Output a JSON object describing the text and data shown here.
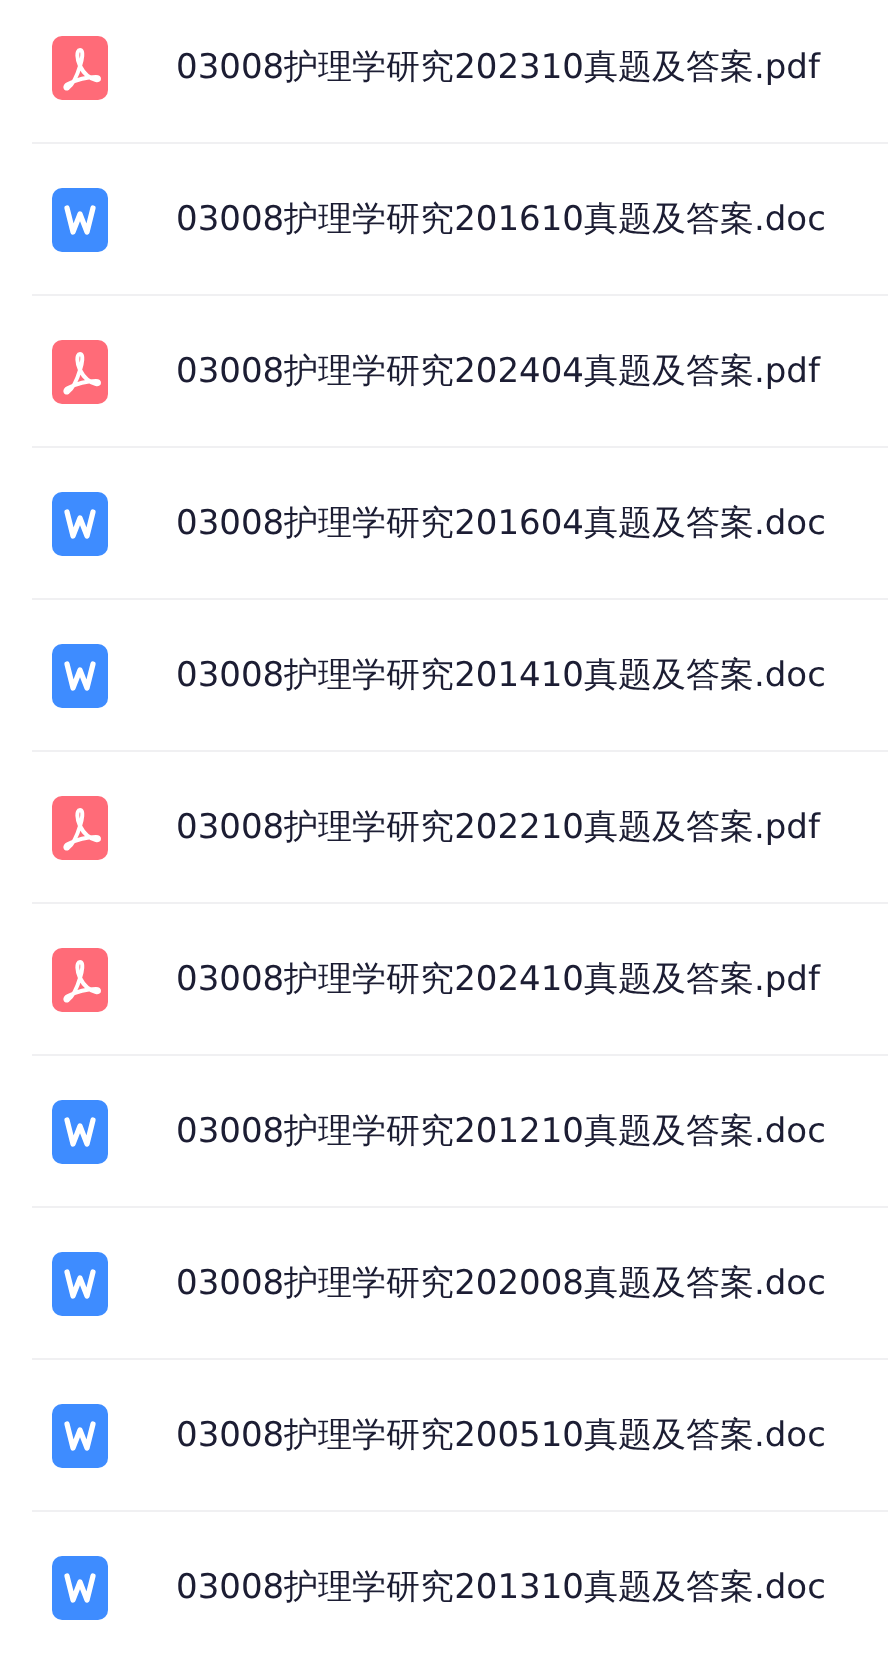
{
  "files": [
    {
      "kind": "pdf",
      "name": "03008护理学研究202310真题及答案.pdf"
    },
    {
      "kind": "doc",
      "name": "03008护理学研究201610真题及答案.doc"
    },
    {
      "kind": "pdf",
      "name": "03008护理学研究202404真题及答案.pdf"
    },
    {
      "kind": "doc",
      "name": "03008护理学研究201604真题及答案.doc"
    },
    {
      "kind": "doc",
      "name": "03008护理学研究201410真题及答案.doc"
    },
    {
      "kind": "pdf",
      "name": "03008护理学研究202210真题及答案.pdf"
    },
    {
      "kind": "pdf",
      "name": "03008护理学研究202410真题及答案.pdf"
    },
    {
      "kind": "doc",
      "name": "03008护理学研究201210真题及答案.doc"
    },
    {
      "kind": "doc",
      "name": "03008护理学研究202008真题及答案.doc"
    },
    {
      "kind": "doc",
      "name": "03008护理学研究200510真题及答案.doc"
    },
    {
      "kind": "doc",
      "name": "03008护理学研究201310真题及答案.doc"
    }
  ]
}
